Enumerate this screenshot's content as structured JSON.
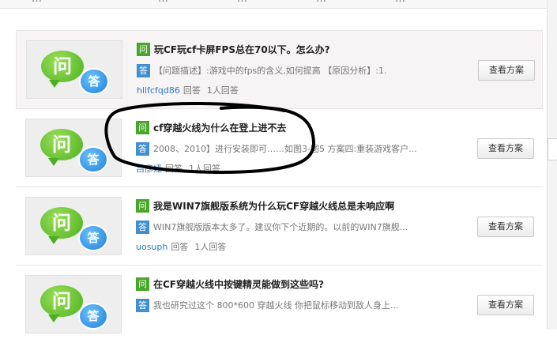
{
  "top_nav": [
    "…",
    "…",
    "…",
    "…",
    "…"
  ],
  "items": [
    {
      "question": "玩CF玩cf卡屏FPS总在70以下。怎么办?",
      "answer": "【问题描述】:游戏中的fps的含义,如何提高 【原因分析】:1.",
      "user": "hllfcfqd86",
      "answer_label": "回答",
      "answer_count": "1人回答",
      "button": "查看方案",
      "q_tag": "问",
      "a_tag": "答",
      "thumb_q": "问",
      "thumb_a": "答"
    },
    {
      "question": "cf穿越火线为什么在登上进不去",
      "answer": "2008、2010】进行安装即可……如图3-图5 方案四:重装游戏客户...",
      "user": "吕彦娅",
      "answer_label": "回答",
      "answer_count": "1人回答",
      "button": "查看方案",
      "q_tag": "问",
      "a_tag": "答",
      "thumb_q": "问",
      "thumb_a": "答"
    },
    {
      "question": "我是WIN7旗舰版系统为什么玩CF穿越火线总是未响应啊",
      "answer": "WIN7旗舰版版本太多了。建议你下个近期的。以前的WIN7旗舰...",
      "user": "uosuph",
      "answer_label": "回答",
      "answer_count": "1人回答",
      "button": "查看方案",
      "q_tag": "问",
      "a_tag": "答",
      "thumb_q": "问",
      "thumb_a": "答"
    },
    {
      "question": "在CF穿越火线中按键精灵能做到这些吗?",
      "answer": "我也研究过这个     800*600 穿越火线 你把鼠标移动到敌人身上...",
      "user": "",
      "answer_label": "",
      "answer_count": "",
      "button": "查看方案",
      "q_tag": "问",
      "a_tag": "答",
      "thumb_q": "问",
      "thumb_a": "答"
    }
  ]
}
